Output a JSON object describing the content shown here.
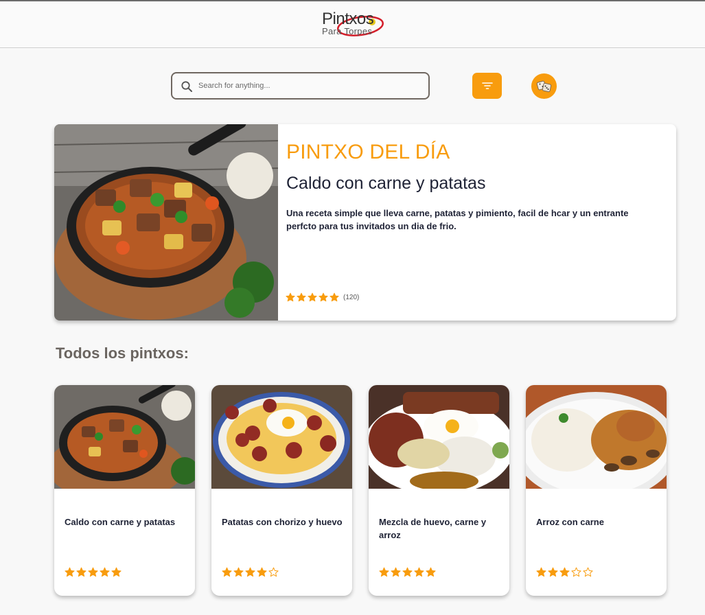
{
  "brand": {
    "logo_main": "Pintxos",
    "logo_sub": "Para Torpes"
  },
  "search": {
    "placeholder": "Search for anything...",
    "value": ""
  },
  "colors": {
    "accent": "#f89c0e",
    "text_dark": "#1e2235",
    "section_title": "#6b6560"
  },
  "icons": {
    "search": "search-icon",
    "filter": "filter-icon",
    "random": "dice-icon",
    "star_full": "star-icon",
    "star_empty": "star-outline-icon"
  },
  "hero": {
    "kicker": "PINTXO DEL DÍA",
    "title": "Caldo con carne y patatas",
    "description": "Una receta simple que lleva carne, patatas y pimiento, facil de hcar y un entrante perfcto para tus invitados un dia de frio.",
    "rating": 5,
    "reviews": "(120)"
  },
  "section_title": "Todos los pintxos:",
  "cards": [
    {
      "title": "Caldo con carne y patatas",
      "rating": 5
    },
    {
      "title": "Patatas con chorizo y huevo",
      "rating": 4
    },
    {
      "title": "Mezcla de huevo, carne y arroz",
      "rating": 5
    },
    {
      "title": "Arroz con carne",
      "rating": 3
    }
  ]
}
